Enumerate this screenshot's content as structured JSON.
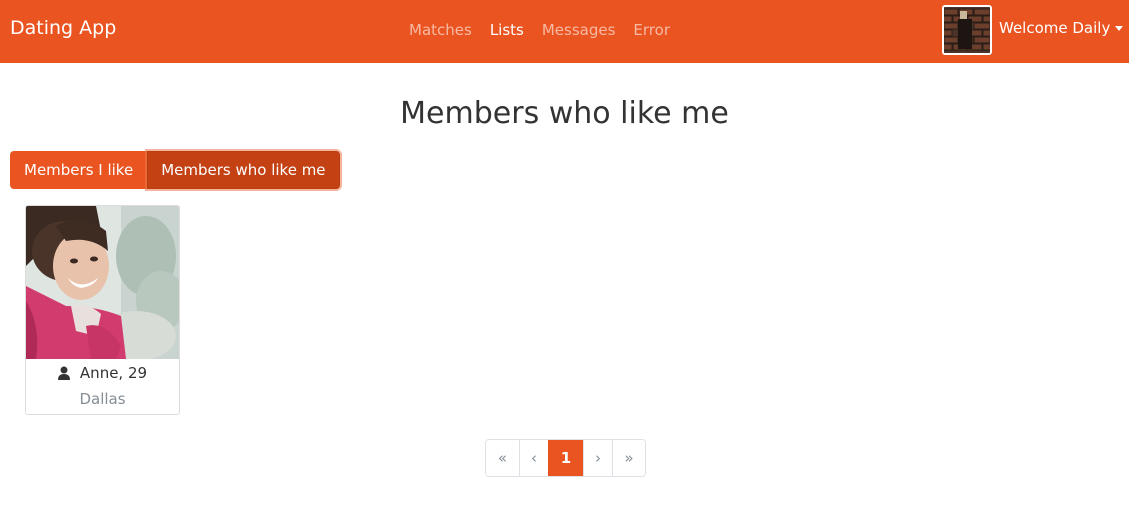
{
  "navbar": {
    "brand": "Dating App",
    "links": [
      {
        "label": "Matches",
        "active": false
      },
      {
        "label": "Lists",
        "active": true
      },
      {
        "label": "Messages",
        "active": false
      },
      {
        "label": "Error",
        "active": false
      }
    ],
    "user_menu_label": "Welcome Daily",
    "user_menu_icon": "chevron-down-icon"
  },
  "page": {
    "title": "Members who like me"
  },
  "filter_buttons": {
    "members_i_like": "Members I like",
    "members_who_like_me": "Members who like me",
    "active": "members_who_like_me"
  },
  "members": [
    {
      "name_age": "Anne, 29",
      "city": "Dallas",
      "icon": "user-icon"
    }
  ],
  "pagination": {
    "first": "«",
    "prev": "‹",
    "current": "1",
    "next": "›",
    "last": "»"
  },
  "colors": {
    "primary": "#e95420",
    "primary_active": "#c34113",
    "muted_text": "#868e96"
  }
}
